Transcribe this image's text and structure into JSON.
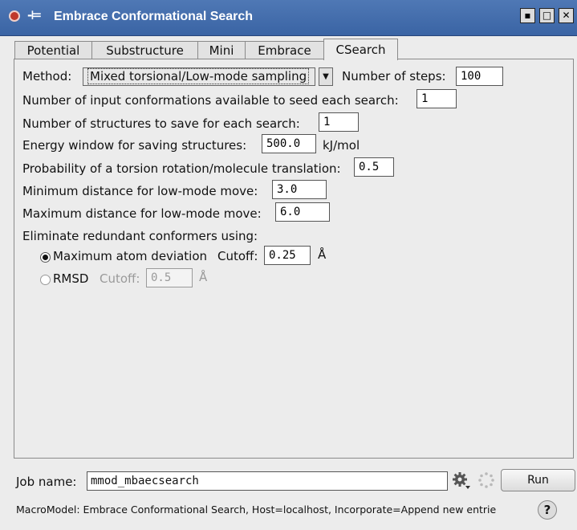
{
  "window": {
    "title": "Embrace Conformational Search",
    "buttons": {
      "minimize": "▪",
      "maximize": "□",
      "close": "✕"
    }
  },
  "tabs": [
    {
      "label": "Potential",
      "active": false
    },
    {
      "label": "Substructure",
      "active": false
    },
    {
      "label": "Mini",
      "active": false
    },
    {
      "label": "Embrace",
      "active": false
    },
    {
      "label": "CSearch",
      "active": true
    }
  ],
  "csearch": {
    "method_label": "Method:",
    "method_value": "Mixed torsional/Low-mode sampling",
    "steps_label": "Number of steps:",
    "steps_value": "100",
    "input_conf_label": "Number of input conformations available to seed each search:",
    "input_conf_value": "1",
    "save_label": "Number of structures to save for each search:",
    "save_value": "1",
    "energy_label": "Energy window for saving structures:",
    "energy_value": "500.0",
    "energy_unit": "kJ/mol",
    "prob_label": "Probability of a torsion rotation/molecule translation:",
    "prob_value": "0.5",
    "min_dist_label": "Minimum distance for low-mode move:",
    "min_dist_value": "3.0",
    "max_dist_label": "Maximum distance for low-mode move:",
    "max_dist_value": "6.0",
    "eliminate_label": "Eliminate redundant conformers using:",
    "opt_max_atom_label": "Maximum atom deviation",
    "opt_max_atom_selected": true,
    "cutoff_label": "Cutoff:",
    "max_atom_cutoff": "0.25",
    "angstrom": "Å",
    "opt_rmsd_label": "RMSD",
    "rmsd_cutoff": "0.5"
  },
  "job": {
    "name_label": "Job name:",
    "name_value": "mmod_mbaecsearch",
    "run_label": "Run"
  },
  "status": {
    "text": "MacroModel: Embrace Conformational Search, Host=localhost, Incorporate=Append new entrie",
    "help": "?"
  }
}
